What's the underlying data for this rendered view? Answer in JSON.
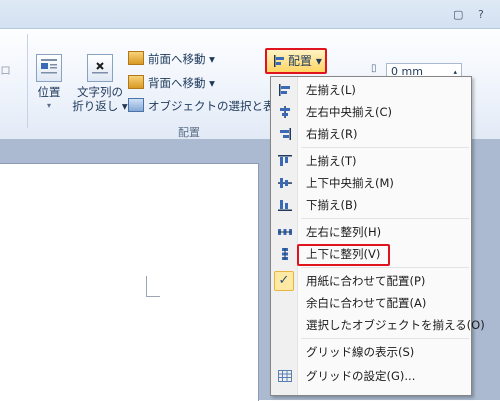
{
  "window": {
    "minimize_glyph": "▢",
    "help_glyph": "?"
  },
  "ribbon": {
    "partial_left_glyph": "ロ",
    "position_button": {
      "label": "位置",
      "icon": "position-icon"
    },
    "wrap_text_button": {
      "label_line1": "文字列の",
      "label_line2": "折り返し"
    },
    "bring_forward": {
      "label": "前面へ移動"
    },
    "send_backward": {
      "label": "背面へ移動"
    },
    "selection_pane": {
      "label": "オブジェクトの選択と表示"
    },
    "group_label": "配置",
    "align_button": {
      "label": "配置"
    },
    "size_value": "0 mm"
  },
  "align_menu": {
    "items": [
      {
        "id": "align-left",
        "label": "左揃え(L)",
        "icon": "align-left-icon"
      },
      {
        "id": "align-center",
        "label": "左右中央揃え(C)",
        "icon": "align-center-icon"
      },
      {
        "id": "align-right",
        "label": "右揃え(R)",
        "icon": "align-right-icon"
      },
      {
        "id": "align-top",
        "label": "上揃え(T)",
        "icon": "align-top-icon"
      },
      {
        "id": "align-middle",
        "label": "上下中央揃え(M)",
        "icon": "align-middle-icon"
      },
      {
        "id": "align-bottom",
        "label": "下揃え(B)",
        "icon": "align-bottom-icon"
      },
      {
        "id": "distribute-horizontal",
        "label": "左右に整列(H)",
        "icon": "distribute-horizontal-icon"
      },
      {
        "id": "distribute-vertical",
        "label": "上下に整列(V)",
        "icon": "distribute-vertical-icon"
      },
      {
        "id": "align-to-page",
        "label": "用紙に合わせて配置(P)",
        "icon": "checkmark-icon",
        "checked": true
      },
      {
        "id": "align-to-margin",
        "label": "余白に合わせて配置(A)"
      },
      {
        "id": "align-selected",
        "label": "選択したオブジェクトを揃える(O)"
      },
      {
        "id": "view-gridlines",
        "label": "グリッド線の表示(S)"
      },
      {
        "id": "grid-settings",
        "label": "グリッドの設定(G)...",
        "icon": "grid-icon"
      }
    ],
    "highlighted_item": "distribute-vertical"
  },
  "colors": {
    "highlight_red": "#e0141f",
    "button_active": "#ffd564",
    "doc_background": "#abbad0"
  }
}
